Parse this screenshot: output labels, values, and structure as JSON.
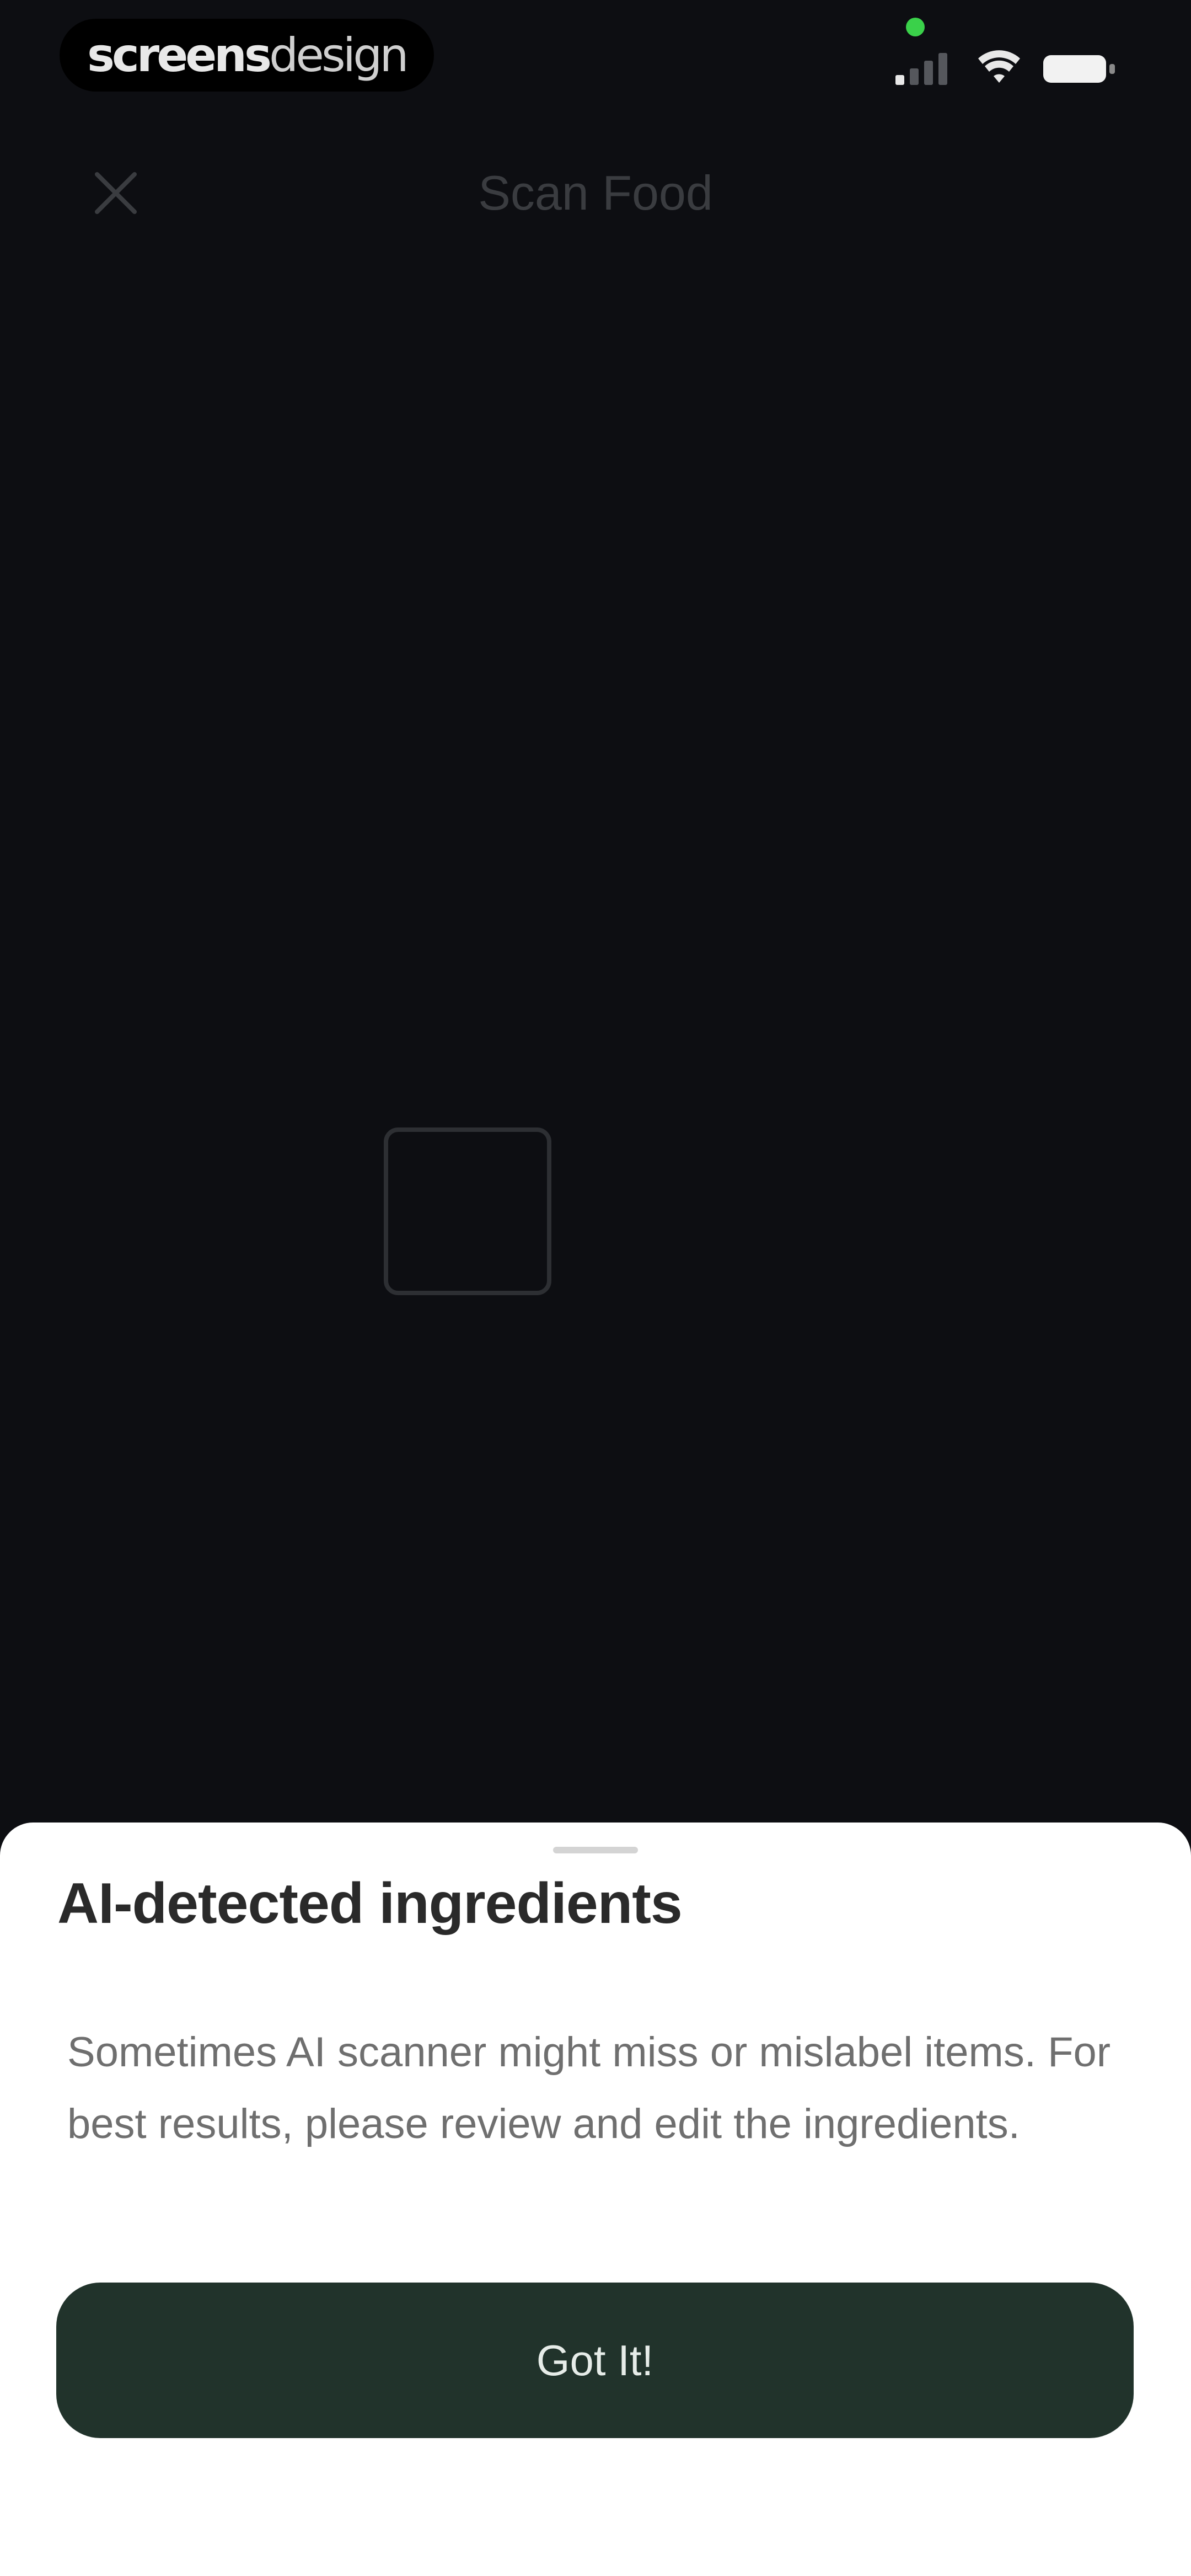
{
  "watermark": {
    "bold": "screens",
    "light": "design"
  },
  "status_bar": {
    "privacy_indicator_color": "#3ad14a",
    "icons": [
      "cellular-signal-icon",
      "wifi-icon",
      "battery-icon"
    ]
  },
  "header": {
    "title": "Scan Food",
    "close_icon": "close-icon"
  },
  "sheet": {
    "title": "AI-detected ingredients",
    "body": "Sometimes AI scanner might miss or mislabel items. For best results, please review and edit the ingredients.",
    "button_label": "Got It!"
  },
  "colors": {
    "background": "#0d0e12",
    "button": "#21332b",
    "sheet": "#ffffff"
  }
}
